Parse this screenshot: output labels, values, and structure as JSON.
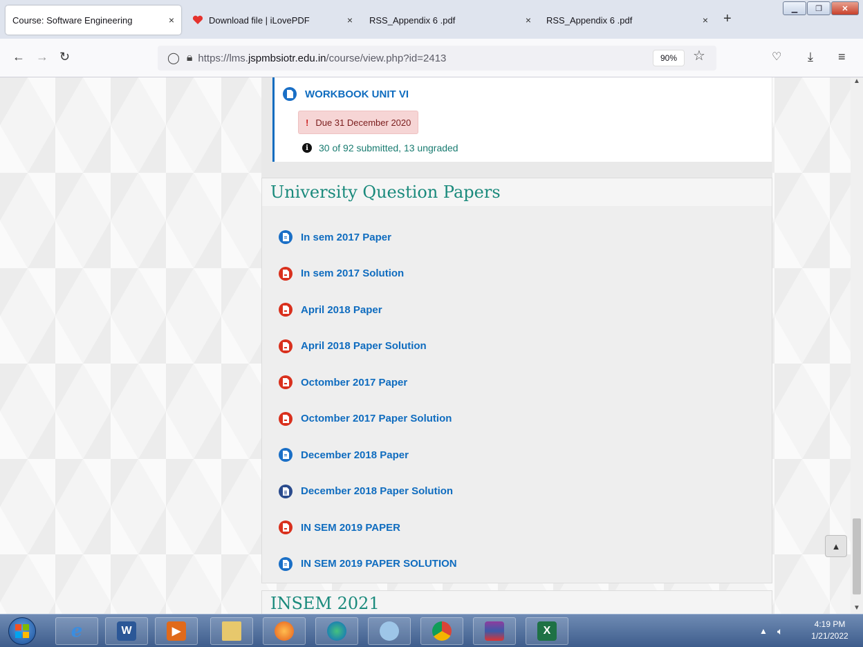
{
  "tabs": [
    {
      "title": "Course: Software Engineering",
      "active": true
    },
    {
      "title": "Download file | iLovePDF",
      "active": false
    },
    {
      "title": "RSS_Appendix 6 .pdf",
      "active": false
    },
    {
      "title": "RSS_Appendix 6 .pdf",
      "active": false
    }
  ],
  "close_glyph": "×",
  "new_tab_glyph": "+",
  "url": {
    "prefix": "https://lms.",
    "host": "jspmbsiotr.edu.in",
    "path": "/course/view.php?id=2413"
  },
  "zoom": "90%",
  "previous_activity": {
    "title": "WORKBOOK UNIT VI",
    "due": "Due 31 December 2020",
    "submissions": "30 of 92 submitted, 13 ungraded"
  },
  "section": {
    "title": "University Question Papers",
    "items": [
      {
        "label": "In sem 2017 Paper",
        "icon": "document-icon",
        "color": "#1a6fc6"
      },
      {
        "label": "In sem 2017 Solution",
        "icon": "pdf-icon",
        "color": "#d9301d"
      },
      {
        "label": "April 2018 Paper",
        "icon": "pdf-icon",
        "color": "#d9301d"
      },
      {
        "label": "April 2018 Paper Solution",
        "icon": "pdf-icon",
        "color": "#d9301d"
      },
      {
        "label": "Octomber 2017 Paper",
        "icon": "pdf-icon",
        "color": "#d9301d"
      },
      {
        "label": "Octomber 2017 Paper Solution",
        "icon": "pdf-icon",
        "color": "#d9301d"
      },
      {
        "label": "December 2018 Paper",
        "icon": "document-icon",
        "color": "#1a6fc6"
      },
      {
        "label": "December 2018 Paper Solution",
        "icon": "file-icon",
        "color": "#2a4b8d"
      },
      {
        "label": "IN SEM 2019 PAPER",
        "icon": "pdf-icon",
        "color": "#d9301d"
      },
      {
        "label": "IN SEM 2019 PAPER SOLUTION",
        "icon": "document-icon",
        "color": "#1a6fc6"
      }
    ]
  },
  "next_section": {
    "title": "INSEM 2021"
  },
  "taskbar": {
    "time": "4:19 PM",
    "date": "1/21/2022"
  }
}
